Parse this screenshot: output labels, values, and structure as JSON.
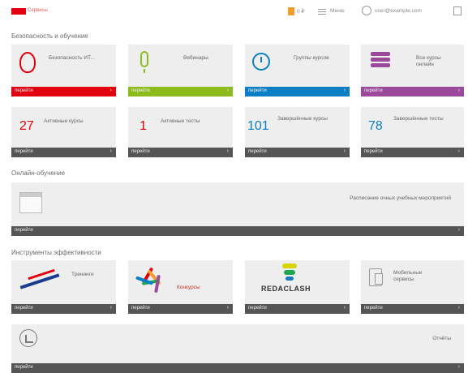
{
  "header": {
    "logo_text": "Сервисы",
    "cart_count": "0",
    "price": "0 ₽",
    "menu_label": "Меню",
    "user_email": "user@example.com"
  },
  "sections": {
    "main_title": "Безопасность и обучение",
    "training_title": "Онлайн-обучение",
    "tools_title": "Инструменты эффективности"
  },
  "tiles_row1": [
    {
      "title": "Безопасность ИТ...",
      "bar": "перейти",
      "color": "#e2000f",
      "icon": "shield-icon"
    },
    {
      "title": "Вебинары",
      "bar": "перейти",
      "color": "#8dbb1c",
      "icon": "microphone-icon"
    },
    {
      "title": "Группы курсов",
      "bar": "перейти",
      "color": "#0b7fc4",
      "icon": "clock-icon"
    },
    {
      "title": "Все курсы онлайн",
      "bar": "перейти",
      "color": "#9b4a9b",
      "icon": "stack-icon"
    }
  ],
  "tiles_row2": [
    {
      "num": "27",
      "num_color": "#e2000f",
      "title": "Активные курсы",
      "bar": "перейти"
    },
    {
      "num": "1",
      "num_color": "#e2000f",
      "title": "Активные тесты",
      "bar": "перейти"
    },
    {
      "num": "101",
      "num_color": "#0b7fc4",
      "title": "Завершённые курсы",
      "bar": "перейти"
    },
    {
      "num": "78",
      "num_color": "#0b7fc4",
      "title": "Завершённые тесты",
      "bar": "перейти"
    }
  ],
  "training": {
    "title": "Расписание очных учебных мероприятий",
    "bar": "перейти",
    "icon": "calendar-icon"
  },
  "tools": [
    {
      "title": "Тренинги",
      "bar": "перейти",
      "icon": "skier-logo"
    },
    {
      "title": "Конкурсы",
      "bar": "перейти",
      "icon": "star-logo"
    },
    {
      "title": "REDACLASH",
      "bar": "перейти",
      "icon": "brush-logo"
    },
    {
      "title": "Мобильные сервисы",
      "bar": "перейти",
      "icon": "device-icon"
    }
  ],
  "reports": {
    "title": "Отчёты",
    "bar": "перейти",
    "icon": "chart-icon"
  },
  "arrow": "›"
}
